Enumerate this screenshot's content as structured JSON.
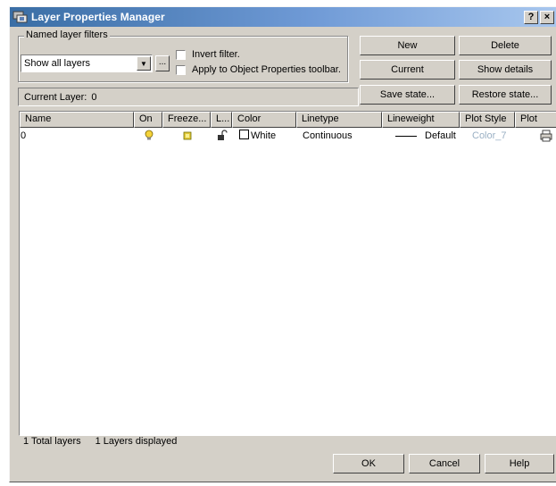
{
  "window": {
    "title": "Layer Properties Manager",
    "help_glyph": "?",
    "close_glyph": "×"
  },
  "filters": {
    "group_label": "Named layer filters",
    "selected": "Show all layers",
    "browse_label": "...",
    "invert_label": "Invert filter.",
    "apply_label": "Apply to Object Properties toolbar."
  },
  "buttons": {
    "new": "New",
    "delete": "Delete",
    "current": "Current",
    "show_details": "Show details",
    "save_state": "Save state...",
    "restore_state": "Restore state...",
    "ok": "OK",
    "cancel": "Cancel",
    "help": "Help"
  },
  "current_layer": {
    "label": "Current Layer:",
    "value": "0"
  },
  "table": {
    "columns": [
      "Name",
      "On",
      "Freeze...",
      "L...",
      "Color",
      "Linetype",
      "Lineweight",
      "Plot Style",
      "Plot"
    ],
    "rows": [
      {
        "name": "0",
        "color": "White",
        "linetype": "Continuous",
        "lineweight": "Default",
        "plot_style": "Color_7"
      }
    ]
  },
  "status": {
    "total": "1 Total layers",
    "displayed": "1 Layers displayed"
  },
  "colors": {
    "plot_style_text": "#9ab0c4",
    "title_start": "#3a6ea5",
    "title_end": "#a8c7ee"
  }
}
